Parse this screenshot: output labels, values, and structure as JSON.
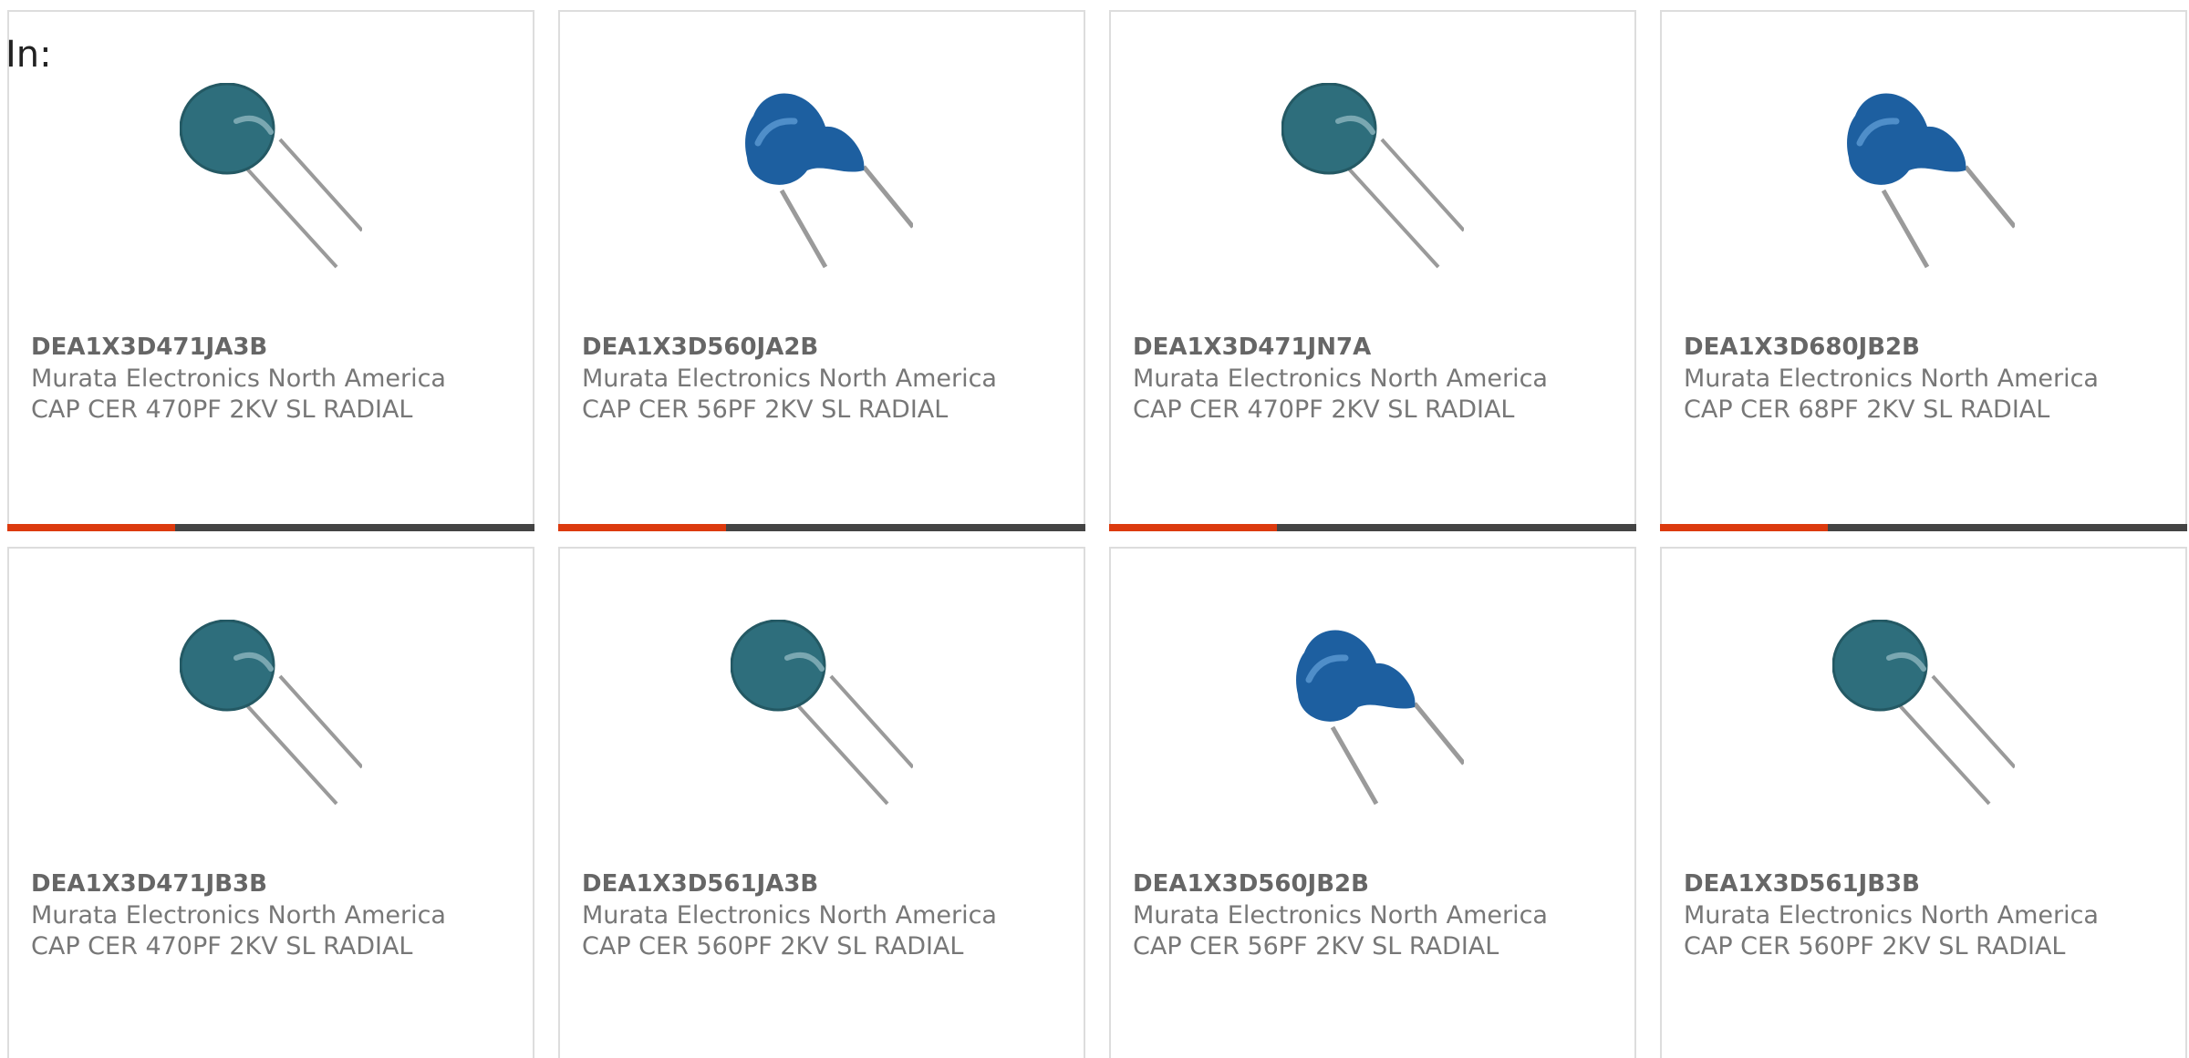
{
  "page": {
    "filter_label": "In:"
  },
  "colors": {
    "accent": "#dc3a0e",
    "bar_dark": "#444444",
    "capacitor_teal": "#2e6e7c",
    "capacitor_blue": "#1d5fa0"
  },
  "products": [
    {
      "part_number": "DEA1X3D471JA3B",
      "manufacturer": "Murata Electronics North America",
      "description": "CAP CER 470PF 2KV SL RADIAL",
      "image_style": "teal-disc-capacitor"
    },
    {
      "part_number": "DEA1X3D560JA2B",
      "manufacturer": "Murata Electronics North America",
      "description": "CAP CER 56PF 2KV SL RADIAL",
      "image_style": "blue-disc-capacitor"
    },
    {
      "part_number": "DEA1X3D471JN7A",
      "manufacturer": "Murata Electronics North America",
      "description": "CAP CER 470PF 2KV SL RADIAL",
      "image_style": "teal-disc-capacitor"
    },
    {
      "part_number": "DEA1X3D680JB2B",
      "manufacturer": "Murata Electronics North America",
      "description": "CAP CER 68PF 2KV SL RADIAL",
      "image_style": "blue-disc-capacitor"
    },
    {
      "part_number": "DEA1X3D471JB3B",
      "manufacturer": "Murata Electronics North America",
      "description": "CAP CER 470PF 2KV SL RADIAL",
      "image_style": "teal-disc-capacitor"
    },
    {
      "part_number": "DEA1X3D561JA3B",
      "manufacturer": "Murata Electronics North America",
      "description": "CAP CER 560PF 2KV SL RADIAL",
      "image_style": "teal-disc-capacitor"
    },
    {
      "part_number": "DEA1X3D560JB2B",
      "manufacturer": "Murata Electronics North America",
      "description": "CAP CER 56PF 2KV SL RADIAL",
      "image_style": "blue-disc-capacitor"
    },
    {
      "part_number": "DEA1X3D561JB3B",
      "manufacturer": "Murata Electronics North America",
      "description": "CAP CER 560PF 2KV SL RADIAL",
      "image_style": "teal-disc-capacitor"
    }
  ]
}
